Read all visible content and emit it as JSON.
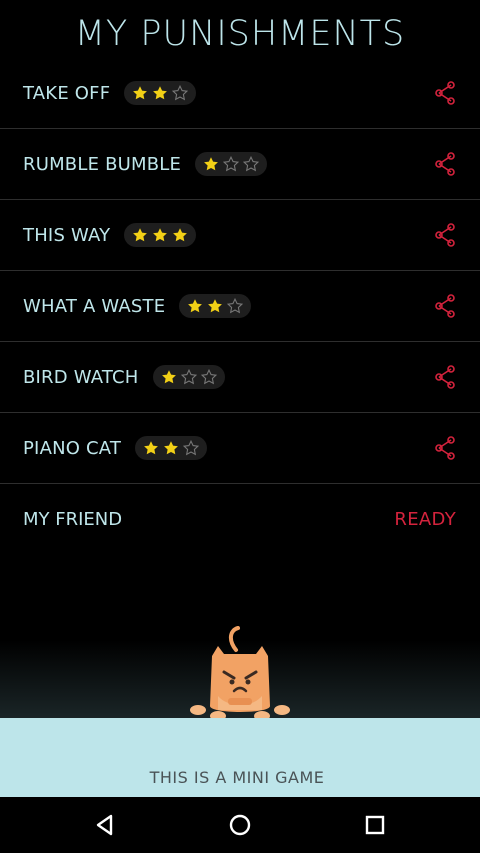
{
  "header": {
    "title": "MY PUNISHMENTS"
  },
  "punishments": [
    {
      "name": "TAKE OFF",
      "stars": 2,
      "max_stars": 3
    },
    {
      "name": "RUMBLE BUMBLE",
      "stars": 1,
      "max_stars": 3
    },
    {
      "name": "THIS WAY",
      "stars": 3,
      "max_stars": 3
    },
    {
      "name": "WHAT A WASTE",
      "stars": 2,
      "max_stars": 3
    },
    {
      "name": "BIRD WATCH",
      "stars": 1,
      "max_stars": 3
    },
    {
      "name": "PIANO CAT",
      "stars": 2,
      "max_stars": 3
    }
  ],
  "friend": {
    "label": "MY FRIEND",
    "status": "READY"
  },
  "footer": {
    "mini_game_label": "THIS IS A MINI GAME"
  },
  "colors": {
    "title": "#bde5ea",
    "star_filled": "#f2d016",
    "star_empty": "#777777",
    "share": "#d4233d",
    "ready": "#d4233d",
    "ground": "#bde5ea",
    "cat": "#f2a264"
  },
  "icons": {
    "share": "share-icon",
    "star": "star-icon",
    "nav_back": "back-triangle-icon",
    "nav_home": "home-circle-icon",
    "nav_recents": "recents-square-icon"
  }
}
